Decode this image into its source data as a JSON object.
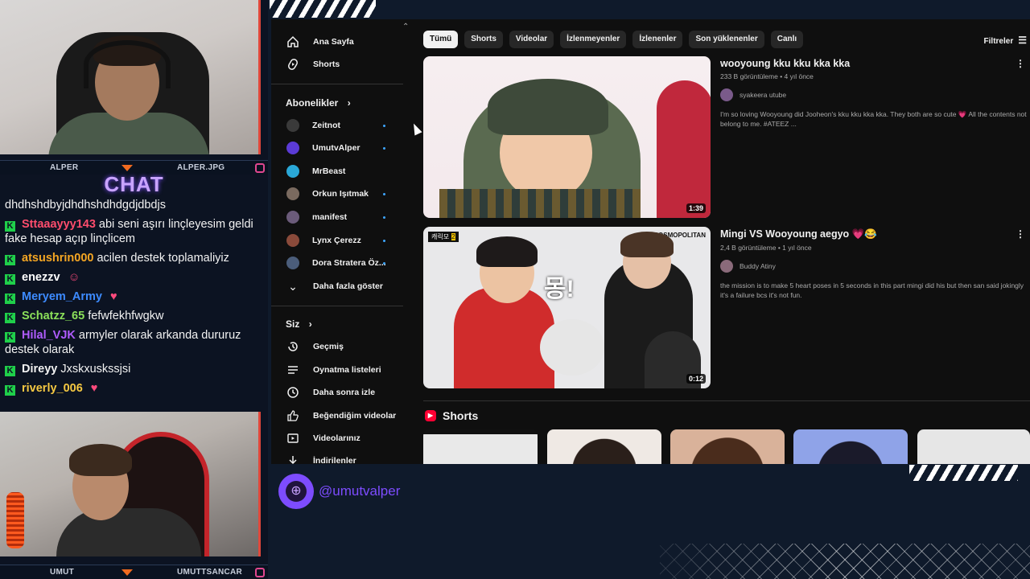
{
  "overlay": {
    "top_nameplate": {
      "left": "ALPER",
      "right": "ALPER.JPG"
    },
    "bottom_nameplate": {
      "left": "UMUT",
      "right": "UMUTTSANCAR"
    },
    "chat_title": "CHAT",
    "handle": "@umutvalper",
    "colors": {
      "accent_purple": "#7d4cff",
      "chat_title": "#c9a3ff",
      "badge_green": "#1fcf4a",
      "plate_orange": "#f06a1f"
    }
  },
  "chat": {
    "first_line": "dhdhshdbyjdhdhshdhdgdjdbdjs",
    "messages": [
      {
        "user": "Sttaaayyy143",
        "text": "abi seni aşırı linçleyesim geldi fake hesap açıp linçlicem",
        "color": "#ff4d6d",
        "emote": ""
      },
      {
        "user": "atsushrin000",
        "text": "acilen destek toplamaliyiz",
        "color": "#f5a623",
        "emote": ""
      },
      {
        "user": "enezzv",
        "text": "",
        "color": "#ffffff",
        "emote": "person-emote"
      },
      {
        "user": "Meryem_Army",
        "text": "",
        "color": "#3d8bff",
        "emote": "heart-hands-emote"
      },
      {
        "user": "Schatzz_65",
        "text": "fefwfekhfwgkw",
        "color": "#8be05a",
        "emote": ""
      },
      {
        "user": "Hilal_VJK",
        "text": "armyler olarak arkanda dururuz destek olarak",
        "color": "#b05cff",
        "emote": ""
      },
      {
        "user": "Direyy",
        "text": "Jxskxuskssjsi",
        "color": "#f2f2f2",
        "emote": ""
      },
      {
        "user": "riverly_006",
        "text": "",
        "color": "#f5c842",
        "emote": "heart-hands-emote"
      }
    ]
  },
  "youtube": {
    "sidebar": {
      "top_items": [
        {
          "label": "Ana Sayfa",
          "icon": "home-icon"
        },
        {
          "label": "Shorts",
          "icon": "shorts-icon"
        }
      ],
      "subscriptions_title": "Abonelikler",
      "subscriptions": [
        {
          "label": "Zeitnot",
          "avatar": "#3a3a3a",
          "new": true
        },
        {
          "label": "UmutvAlper",
          "avatar": "#5b3bd6",
          "new": true
        },
        {
          "label": "MrBeast",
          "avatar": "#2aa8d8",
          "new": false
        },
        {
          "label": "Orkun Işıtmak",
          "avatar": "#7a6a5f",
          "new": true
        },
        {
          "label": "manifest",
          "avatar": "#6b5b7a",
          "new": true
        },
        {
          "label": "Lynx Çerezz",
          "avatar": "#8a4a3a",
          "new": true
        },
        {
          "label": "Dora Stratera Öz...",
          "avatar": "#4b5d7a",
          "new": true
        }
      ],
      "show_more": "Daha fazla göster",
      "you_title": "Siz",
      "you_items": [
        {
          "label": "Geçmiş",
          "icon": "history-icon"
        },
        {
          "label": "Oynatma listeleri",
          "icon": "playlist-icon"
        },
        {
          "label": "Daha sonra izle",
          "icon": "clock-icon"
        },
        {
          "label": "Beğendiğim videolar",
          "icon": "thumbs-up-icon"
        },
        {
          "label": "Videolarınız",
          "icon": "video-icon"
        },
        {
          "label": "İndirilenler",
          "icon": "download-icon"
        }
      ]
    },
    "chips": [
      "Tümü",
      "Shorts",
      "Videolar",
      "İzlenmeyenler",
      "İzlenenler",
      "Son yüklenenler",
      "Canlı"
    ],
    "active_chip": "Tümü",
    "filters_label": "Filtreler",
    "videos": [
      {
        "title": "wooyoung kku kku kka kka",
        "meta": "233 B görüntüleme • 4 yıl önce",
        "channel": "syakeera utube",
        "description": "I'm so loving Wooyoung did Jooheon's kku kku kka kka. They both are so cute 💗 All the contents not belong to me. #ATEEZ ...",
        "duration": "1:39"
      },
      {
        "title": "Mingi VS Wooyoung aegyo 💗😂",
        "meta": "2,4 B görüntüleme • 1 yıl önce",
        "channel": "Buddy Atiny",
        "description": "the mission is to make 5 heart poses in 5 seconds in this part mingi did his but then san said jokingly it's a failure bcs it's not fun.",
        "duration": "0:12",
        "thumb_text": "몽!",
        "thumb_brand": "COSMOPOLITAN"
      }
    ],
    "shorts_title": "Shorts"
  }
}
